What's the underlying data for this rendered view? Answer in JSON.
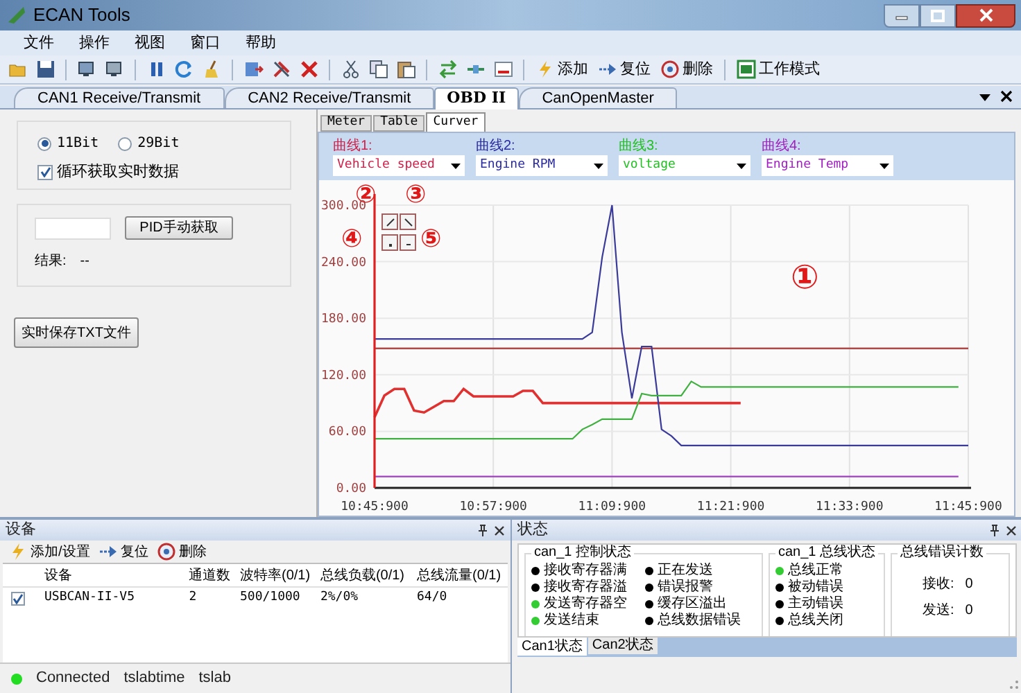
{
  "window": {
    "title": "ECAN Tools"
  },
  "menu": [
    "文件",
    "操作",
    "视图",
    "窗口",
    "帮助"
  ],
  "toolbar": [
    {
      "label": "添加"
    },
    {
      "label": "复位"
    },
    {
      "label": "删除"
    },
    {
      "label": "工作模式"
    }
  ],
  "doc_tabs": [
    {
      "label": "CAN1 Receive/Transmit",
      "selected": false
    },
    {
      "label": "CAN2 Receive/Transmit",
      "selected": false
    },
    {
      "label": "OBD II",
      "selected": true
    },
    {
      "label": "CanOpenMaster",
      "selected": false
    }
  ],
  "obd": {
    "id_mode": [
      {
        "label": "11Bit",
        "selected": true
      },
      {
        "label": "29Bit",
        "selected": false
      }
    ],
    "loop_read": {
      "label": "循环获取实时数据",
      "checked": true
    },
    "pid_button": "PID手动获取",
    "result_label": "结果:",
    "result_value": "--",
    "save_button": "实时保存TXT文件"
  },
  "view_tabs": [
    {
      "label": "Meter",
      "selected": false
    },
    {
      "label": "Table",
      "selected": false
    },
    {
      "label": "Curver",
      "selected": true
    }
  ],
  "curves": [
    {
      "label": "曲线1:",
      "color": "#d0204a"
    },
    {
      "label": "曲线2:",
      "color": "#2a2aa0"
    },
    {
      "label": "曲线3:",
      "color": "#22c022"
    },
    {
      "label": "曲线4:",
      "color": "#a020c0"
    }
  ],
  "chart_data": {
    "type": "line",
    "categories": [
      "10:45:900",
      null,
      null,
      null,
      null,
      null,
      null,
      null,
      null,
      null,
      null,
      null,
      "10:57:900",
      null,
      null,
      null,
      null,
      null,
      null,
      null,
      null,
      null,
      null,
      null,
      "11:09:900",
      null,
      null,
      null,
      null,
      null,
      null,
      null,
      null,
      null,
      null,
      null,
      "11:21:900",
      null,
      null,
      null,
      null,
      null,
      null,
      null,
      null,
      null,
      null,
      null,
      "11:33:900",
      null,
      null,
      null,
      null,
      null,
      null,
      null,
      null,
      null,
      null,
      null,
      "11:45:900"
    ],
    "series": [
      {
        "name": "Vehicle speed",
        "color": "#e03030",
        "values": [
          75,
          98,
          105,
          105,
          82,
          80,
          86,
          92,
          92,
          105,
          97,
          97,
          97,
          97,
          97,
          103,
          103,
          90,
          90,
          90,
          90,
          90,
          90,
          90,
          90,
          90,
          90,
          90,
          90,
          90,
          90,
          90,
          90,
          90,
          90,
          90,
          90,
          90,
          null,
          null,
          null,
          null,
          null,
          null,
          null,
          null,
          null,
          null,
          null,
          null,
          null,
          null,
          null,
          null,
          null,
          null,
          null,
          null,
          null,
          null,
          null
        ]
      },
      {
        "name": "Engine RPM",
        "color": "#3a3a9a",
        "values": [
          158,
          158,
          158,
          158,
          158,
          158,
          158,
          158,
          158,
          158,
          158,
          158,
          158,
          158,
          158,
          158,
          158,
          158,
          158,
          158,
          158,
          158,
          165,
          245,
          300,
          165,
          95,
          150,
          150,
          62,
          55,
          45,
          45,
          45,
          45,
          45,
          45,
          45,
          45,
          45,
          45,
          45,
          45,
          45,
          45,
          45,
          45,
          45,
          45,
          45,
          45,
          45,
          45,
          45,
          45,
          45,
          45,
          45,
          45,
          45,
          45
        ]
      },
      {
        "name": "voltage",
        "color": "#40b040",
        "values": [
          52,
          52,
          52,
          52,
          52,
          52,
          52,
          52,
          52,
          52,
          52,
          52,
          52,
          52,
          52,
          52,
          52,
          52,
          52,
          52,
          52,
          62,
          67,
          73,
          73,
          73,
          73,
          100,
          98,
          98,
          98,
          98,
          113,
          107,
          107,
          107,
          107,
          107,
          107,
          107,
          107,
          107,
          107,
          107,
          107,
          107,
          107,
          107,
          107,
          107,
          107,
          107,
          107,
          107,
          107,
          107,
          107,
          107,
          107,
          107,
          null
        ]
      },
      {
        "name": "Engine Temp",
        "color": "#a040c0",
        "values": [
          12,
          12,
          12,
          12,
          12,
          12,
          12,
          12,
          12,
          12,
          12,
          12,
          12,
          12,
          12,
          12,
          12,
          12,
          12,
          12,
          12,
          12,
          12,
          12,
          12,
          12,
          12,
          12,
          12,
          12,
          12,
          12,
          12,
          12,
          12,
          12,
          12,
          12,
          12,
          12,
          12,
          12,
          12,
          12,
          12,
          12,
          12,
          12,
          12,
          12,
          12,
          12,
          12,
          12,
          12,
          12,
          12,
          12,
          12,
          12,
          null
        ]
      }
    ],
    "ylim": [
      0,
      300
    ],
    "grid": true,
    "yticks": [
      {
        "value": 0,
        "label": "0.00"
      },
      {
        "value": 60,
        "label": "60.00"
      },
      {
        "value": 120,
        "label": "120.00"
      },
      {
        "value": 180,
        "label": "180.00"
      },
      {
        "value": 240,
        "label": "240.00"
      },
      {
        "value": 300,
        "label": "300.00"
      }
    ],
    "ref_lines": [
      {
        "axis": "y",
        "value": 148
      }
    ]
  },
  "callouts": [
    "①",
    "②",
    "③",
    "④",
    "⑤"
  ],
  "device_panel": {
    "title": "设备",
    "toolbar": [
      "添加/设置",
      "复位",
      "删除"
    ],
    "columns": [
      "设备",
      "通道数",
      "波特率(0/1)",
      "总线负载(0/1)",
      "总线流量(0/1)"
    ],
    "rows": [
      {
        "checked": true,
        "cells": [
          "USBCAN-II-V5",
          "2",
          "500/1000",
          "2%/0%",
          "64/0"
        ]
      }
    ]
  },
  "status_panel": {
    "title": "状态",
    "groups": [
      {
        "kind": "indicators",
        "title": "can_1 控制状态",
        "items": [
          {
            "label": "接收寄存器满",
            "color": "#000000"
          },
          {
            "label": "接收寄存器溢",
            "color": "#000000"
          },
          {
            "label": "发送寄存器空",
            "color": "#33cc33"
          },
          {
            "label": "发送结束",
            "color": "#33cc33"
          },
          {
            "label": "正在发送",
            "color": "#000000"
          },
          {
            "label": "错误报警",
            "color": "#000000"
          },
          {
            "label": "缓存区溢出",
            "color": "#000000"
          },
          {
            "label": "总线数据错误",
            "color": "#000000"
          }
        ]
      },
      {
        "kind": "indicators",
        "title": "can_1 总线状态",
        "items": [
          {
            "label": "总线正常",
            "color": "#33cc33"
          },
          {
            "label": "被动错误",
            "color": "#000000"
          },
          {
            "label": "主动错误",
            "color": "#000000"
          },
          {
            "label": "总线关闭",
            "color": "#000000"
          }
        ]
      },
      {
        "kind": "counters",
        "title": "总线错误计数",
        "items": [
          {
            "label": "接收:",
            "value": "0"
          },
          {
            "label": "发送:",
            "value": "0"
          }
        ]
      }
    ],
    "tabs": [
      {
        "label": "Can1状态",
        "selected": true
      },
      {
        "label": "Can2状态",
        "selected": false
      }
    ]
  },
  "status_bar": [
    "Connected",
    "tslabtime",
    "tslab"
  ]
}
